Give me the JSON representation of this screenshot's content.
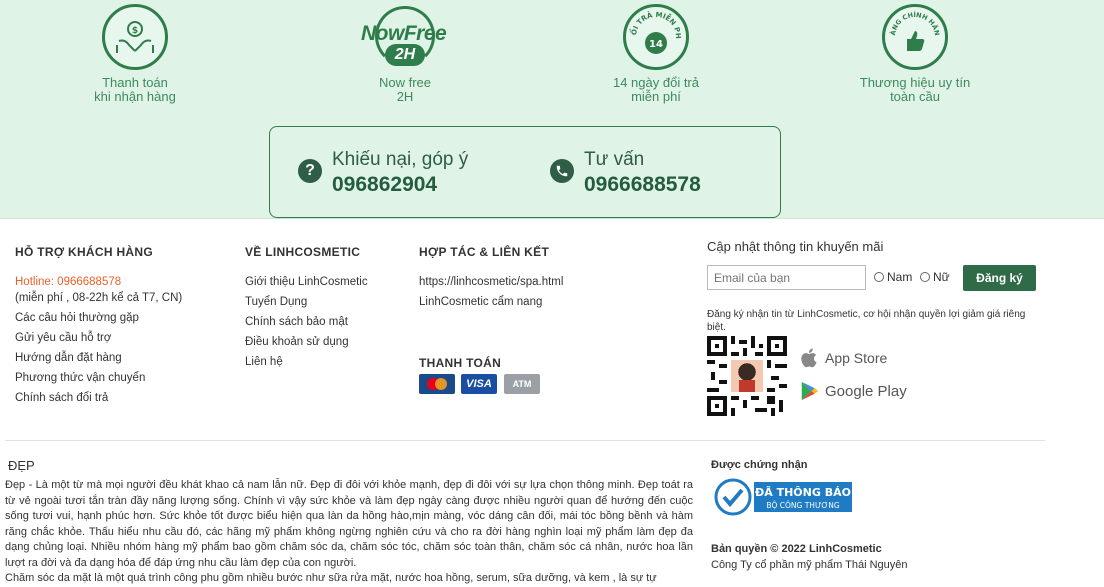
{
  "features": [
    {
      "icon": "hands-money-icon",
      "line1": "Thanh toán",
      "line2": "khi nhận hàng"
    },
    {
      "icon": "now-free-2h-icon",
      "logo_text": "NowFree",
      "logo_sub": "2H",
      "line1": "Now free",
      "line2": "2H"
    },
    {
      "icon": "14-day-return-icon",
      "logo_text": "ĐỔI TRẢ MIỄN PHÍ",
      "logo_num": "14",
      "line1": "14 ngày đổi trả",
      "line2": "miễn phí"
    },
    {
      "icon": "genuine-brand-icon",
      "logo_text": "HÀNG CHÍNH HÃNG",
      "line1": "Thương hiệu uy tín",
      "line2": "toàn cầu"
    }
  ],
  "contact": {
    "complaint_label": "Khiếu nại, góp ý",
    "complaint_phone": "096862904",
    "consult_label": "Tư vấn",
    "consult_phone": "0966688578"
  },
  "support": {
    "title": "HỖ TRỢ KHÁCH HÀNG",
    "hotline": "Hotline: 0966688578",
    "hotline_note": "(miễn phí , 08-22h kể cả T7, CN)",
    "links": [
      "Các câu hỏi thường gặp",
      "Gửi yêu cầu hỗ trợ",
      "Hướng dẫn đặt hàng",
      "Phương thức vận chuyển",
      "Chính sách đổi trả"
    ]
  },
  "about": {
    "title": "VỀ LINHCOSMETIC",
    "links": [
      "Giới thiệu LinhCosmetic",
      "Tuyển Dụng",
      "Chính sách bảo mật",
      "Điều khoản sử dụng",
      "Liên hệ"
    ]
  },
  "partner": {
    "title": "HỢP TÁC & LIÊN KẾT",
    "links": [
      "https://linhcosmetic/spa.html",
      "LinhCosmetic cẩm nang"
    ],
    "payment_title": "THANH TOÁN",
    "payment_methods": [
      "Mastercard",
      "VISA",
      "ATM"
    ]
  },
  "newsletter": {
    "title": "Cập nhật thông tin khuyến mãi",
    "email_placeholder": "Email của bạn",
    "gender_male": "Nam",
    "gender_female": "Nữ",
    "submit_label": "Đăng ký",
    "note": "Đăng ký nhận tin từ LinhCosmetic, cơ hội nhận quyền lợi giảm giá riêng biệt.",
    "app_store": "App Store",
    "google_play": "Google Play"
  },
  "about_beauty": {
    "title": "ĐẸP",
    "text": "Đẹp - Là một từ mà mọi người đều khát khao cả nam lẫn nữ. Đẹp đi đôi với khỏe mạnh, đẹp đi đôi với sự lựa chọn thông minh. Đẹp toát ra từ vẻ ngoài tươi tắn tràn đầy năng lượng sống. Chính vì vậy sức khỏe và làm đẹp ngày càng được nhiều người quan để hướng đến cuộc sống tươi vui, hạnh phúc hơn. Sức khỏe tốt được biểu hiện qua làn da hồng hào,mịn màng, vóc dáng cân đối, mái tóc bồng bềnh và hàm răng chắc khỏe. Thấu hiểu nhu cầu đó, các hãng mỹ phẩm không ngừng nghiên cứu và cho ra đời hàng nghìn loại mỹ phẩm làm đẹp đa dạng chủng loại. Nhiều nhóm hàng mỹ phẩm bao gồm chăm sóc da, chăm sóc tóc, chăm sóc toàn thân, chăm sóc cá nhân, nước hoa lần lượt ra đời và đa dạng hóa để đáp ứng nhu cầu làm đẹp của con người.",
    "text2": "Chăm sóc da mặt là một quá trình công phu gồm nhiều bước như sữa rửa mặt, nước hoa hồng, serum, sữa dưỡng, và kem , là sự tự"
  },
  "certification": {
    "title": "Được chứng nhận",
    "badge_main": "ĐÃ THÔNG BÁO",
    "badge_sub": "BỘ CÔNG THƯƠNG",
    "copyright": "Bản quyền © 2022 LinhCosmetic",
    "company": "Công Ty cổ phần mỹ phẩm Thái Nguyên"
  },
  "colors": {
    "band": "#dff3e6",
    "brand_green": "#2f7d4a",
    "button": "#2f6b47",
    "hotline": "#e8612a"
  }
}
